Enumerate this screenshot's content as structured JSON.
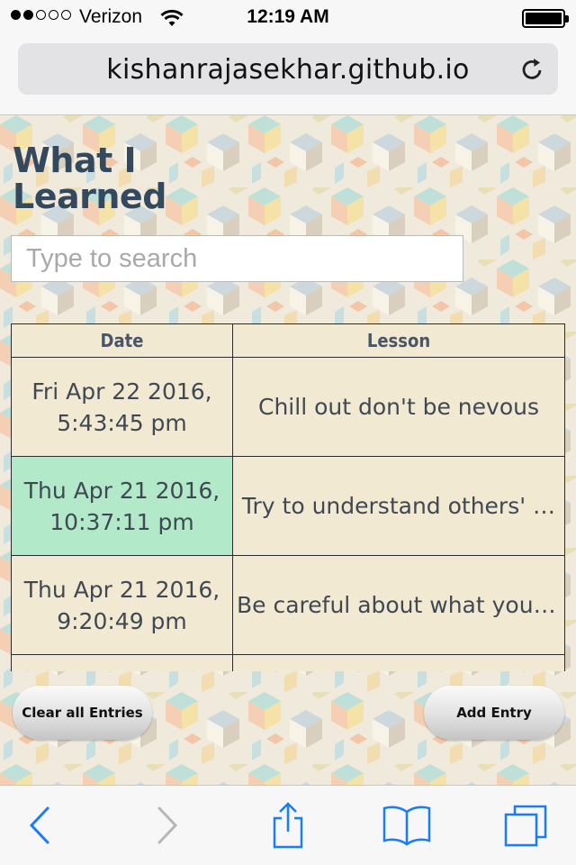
{
  "status_bar": {
    "carrier": "Verizon",
    "time": "12:19 AM",
    "signal_bars_filled": 2,
    "signal_bars_total": 5
  },
  "browser": {
    "url": "kishanrajasekhar.github.io"
  },
  "page": {
    "title": "What I Learned",
    "search": {
      "placeholder": "Type to search",
      "value": ""
    },
    "table": {
      "headers": {
        "date": "Date",
        "lesson": "Lesson"
      },
      "rows": [
        {
          "date": "Fri Apr 22 2016, 5:43:45 pm",
          "lesson": "Chill out don't be nevous",
          "selected": false
        },
        {
          "date": "Thu Apr 21 2016, 10:37:11 pm",
          "lesson": "Try to understand others' …",
          "selected": true
        },
        {
          "date": "Thu Apr 21 2016, 9:20:49 pm",
          "lesson": "Be careful about what you …",
          "selected": false
        },
        {
          "date": "",
          "lesson": "",
          "selected": false
        }
      ]
    },
    "buttons": {
      "clear_all": "Clear all Entries",
      "add_entry": "Add Entry"
    }
  },
  "toolbar": {
    "icons": [
      "back-icon",
      "forward-icon",
      "share-icon",
      "bookmarks-icon",
      "tabs-icon"
    ]
  },
  "colors": {
    "title": "#34495e",
    "selected_row": "#b1e9c9",
    "table_bg": "#f1e9d2",
    "ios_blue": "#1a7bfb"
  }
}
